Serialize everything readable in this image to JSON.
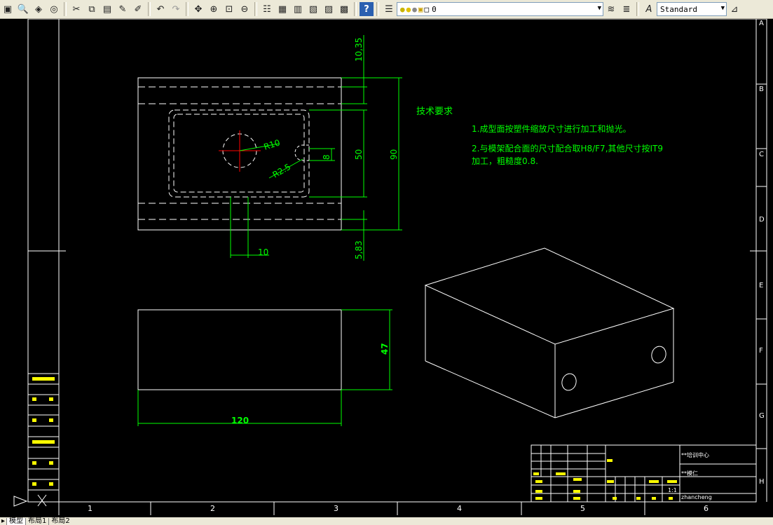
{
  "toolbar": {
    "layer_value": "0",
    "text_style_value": "Standard"
  },
  "drawing": {
    "dimensions": {
      "top_gap": "10,35",
      "cavity_height": "50",
      "overall_height": "90",
      "bottom_gap": "5,83",
      "slot_width": "10",
      "slot_depth": "8",
      "radius_hole": "R10",
      "radius_corner": "R2.5",
      "thickness": "47",
      "length": "120"
    },
    "tech_req": {
      "title": "技术要求",
      "line1": "1.成型面按塑件缩放尺寸进行加工和抛光。",
      "line2a": "2.与模架配合面的尺寸配合取H8/F7,其他尺寸按IT9",
      "line2b": "加工，粗糙度0.8."
    },
    "zone_letters": [
      "A",
      "B",
      "C",
      "D",
      "E",
      "F",
      "G",
      "H"
    ],
    "zone_numbers": [
      "1",
      "2",
      "3",
      "4",
      "5",
      "6"
    ],
    "title_block": {
      "org": "**培训中心",
      "part": "**模仁",
      "scale": "1:1",
      "user": "zhancheng"
    }
  },
  "tabs": {
    "model": "模型",
    "layout1": "布局1",
    "layout2": "布局2"
  }
}
